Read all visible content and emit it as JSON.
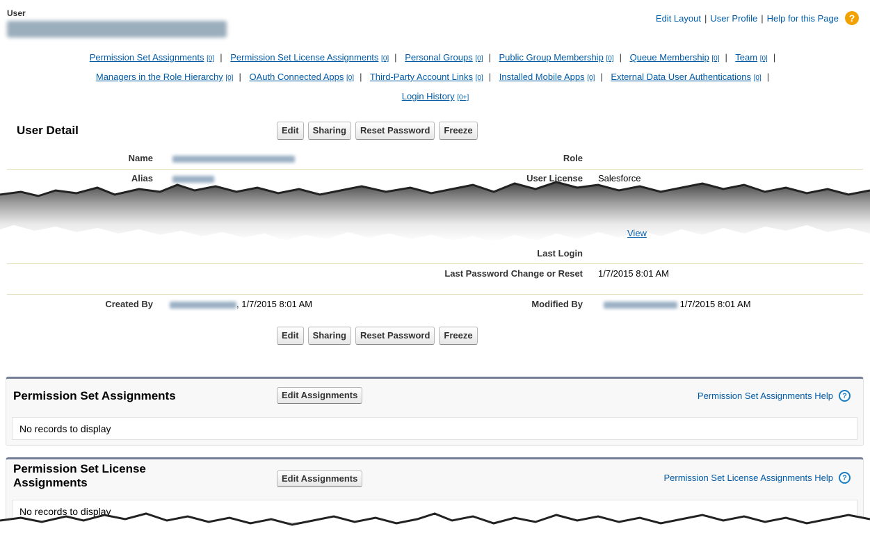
{
  "header": {
    "object_label": "User",
    "top_links": [
      "Edit Layout",
      "User Profile",
      "Help for this Page"
    ],
    "help_icon": "help-circle-icon"
  },
  "related_links": [
    {
      "label": "Permission Set Assignments",
      "count": "[0]"
    },
    {
      "label": "Permission Set License Assignments",
      "count": "[0]"
    },
    {
      "label": "Personal Groups",
      "count": "[0]"
    },
    {
      "label": "Public Group Membership",
      "count": "[0]"
    },
    {
      "label": "Queue Membership",
      "count": "[0]"
    },
    {
      "label": "Team",
      "count": "[0]"
    },
    {
      "label": "Managers in the Role Hierarchy",
      "count": "[0]"
    },
    {
      "label": "OAuth Connected Apps",
      "count": "[0]"
    },
    {
      "label": "Third-Party Account Links",
      "count": "[0]"
    },
    {
      "label": "Installed Mobile Apps",
      "count": "[0]"
    },
    {
      "label": "External Data User Authentications",
      "count": "[0]"
    },
    {
      "label": "Login History",
      "count": "[0+]"
    }
  ],
  "detail": {
    "title": "User Detail",
    "buttons": [
      "Edit",
      "Sharing",
      "Reset Password",
      "Freeze"
    ],
    "fields": {
      "name_label": "Name",
      "alias_label": "Alias",
      "role_label": "Role",
      "user_license_label": "User License",
      "user_license_value": "Salesforce",
      "view_link": "View",
      "last_login_label": "Last Login",
      "last_pw_label": "Last Password Change or Reset",
      "last_pw_value": "1/7/2015 8:01 AM",
      "created_by_label": "Created By",
      "created_by_value": ", 1/7/2015 8:01 AM",
      "modified_by_label": "Modified By",
      "modified_by_value": " 1/7/2015 8:01 AM"
    }
  },
  "related_lists": [
    {
      "title": "Permission Set Assignments",
      "button": "Edit Assignments",
      "help": "Permission Set Assignments Help",
      "empty": "No records to display"
    },
    {
      "title": "Permission Set License Assignments",
      "button": "Edit Assignments",
      "help": "Permission Set License Assignments Help",
      "empty": "No records to display"
    }
  ],
  "colors": {
    "link": "#015ba7",
    "help_orange": "#f2a200",
    "section_border": "#747e96"
  }
}
